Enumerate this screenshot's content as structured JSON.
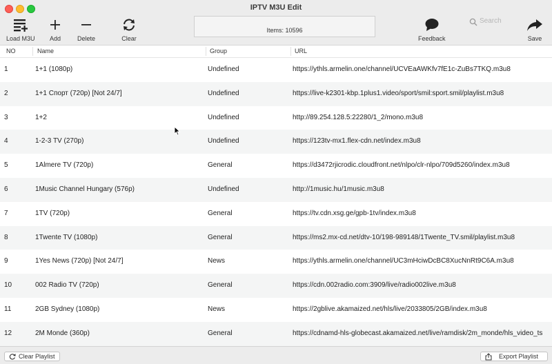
{
  "window": {
    "title": "IPTV M3U Edit"
  },
  "toolbar": {
    "load_m3u_label": "Load M3U",
    "add_label": "Add",
    "delete_label": "Delete",
    "clear_label": "Clear",
    "items_text": "Items: 10596",
    "feedback_label": "Feedback",
    "search_placeholder": "Search",
    "save_label": "Save"
  },
  "table": {
    "headers": {
      "no": "NO",
      "name": "Name",
      "group": "Group",
      "url": "URL"
    },
    "rows": [
      {
        "no": "1",
        "name": "1+1 (1080p)",
        "group": "Undefined",
        "url": "https://ythls.armelin.one/channel/UCVEaAWKfv7fE1c-ZuBs7TKQ.m3u8"
      },
      {
        "no": "2",
        "name": "1+1 Спорт (720p) [Not 24/7]",
        "group": "Undefined",
        "url": "https://live-k2301-kbp.1plus1.video/sport/smil:sport.smil/playlist.m3u8"
      },
      {
        "no": "3",
        "name": "1+2",
        "group": "Undefined",
        "url": "http://89.254.128.5:22280/1_2/mono.m3u8"
      },
      {
        "no": "4",
        "name": "1-2-3 TV (270p)",
        "group": "Undefined",
        "url": "https://123tv-mx1.flex-cdn.net/index.m3u8"
      },
      {
        "no": "5",
        "name": "1Almere TV (720p)",
        "group": "General",
        "url": "https://d3472rjicrodic.cloudfront.net/nlpo/clr-nlpo/709d5260/index.m3u8"
      },
      {
        "no": "6",
        "name": "1Music Channel Hungary (576p)",
        "group": "Undefined",
        "url": "http://1music.hu/1music.m3u8"
      },
      {
        "no": "7",
        "name": "1TV (720p)",
        "group": "General",
        "url": "https://tv.cdn.xsg.ge/gpb-1tv/index.m3u8"
      },
      {
        "no": "8",
        "name": "1Twente TV (1080p)",
        "group": "General",
        "url": "https://ms2.mx-cd.net/dtv-10/198-989148/1Twente_TV.smil/playlist.m3u8"
      },
      {
        "no": "9",
        "name": "1Yes News (720p) [Not 24/7]",
        "group": "News",
        "url": "https://ythls.armelin.one/channel/UC3mHciwDcBC8XucNnRt9C6A.m3u8"
      },
      {
        "no": "10",
        "name": "002 Radio TV (720p)",
        "group": "General",
        "url": "https://cdn.002radio.com:3909/live/radio002live.m3u8"
      },
      {
        "no": "11",
        "name": "2GB Sydney (1080p)",
        "group": "News",
        "url": "https://2gblive.akamaized.net/hls/live/2033805/2GB/index.m3u8"
      },
      {
        "no": "12",
        "name": "2M Monde (360p)",
        "group": "General",
        "url": "https://cdnamd-hls-globecast.akamaized.net/live/ramdisk/2m_monde/hls_video_ts"
      }
    ]
  },
  "footer": {
    "clear_playlist_label": "Clear Playlist",
    "export_playlist_label": "Export Playlist"
  }
}
